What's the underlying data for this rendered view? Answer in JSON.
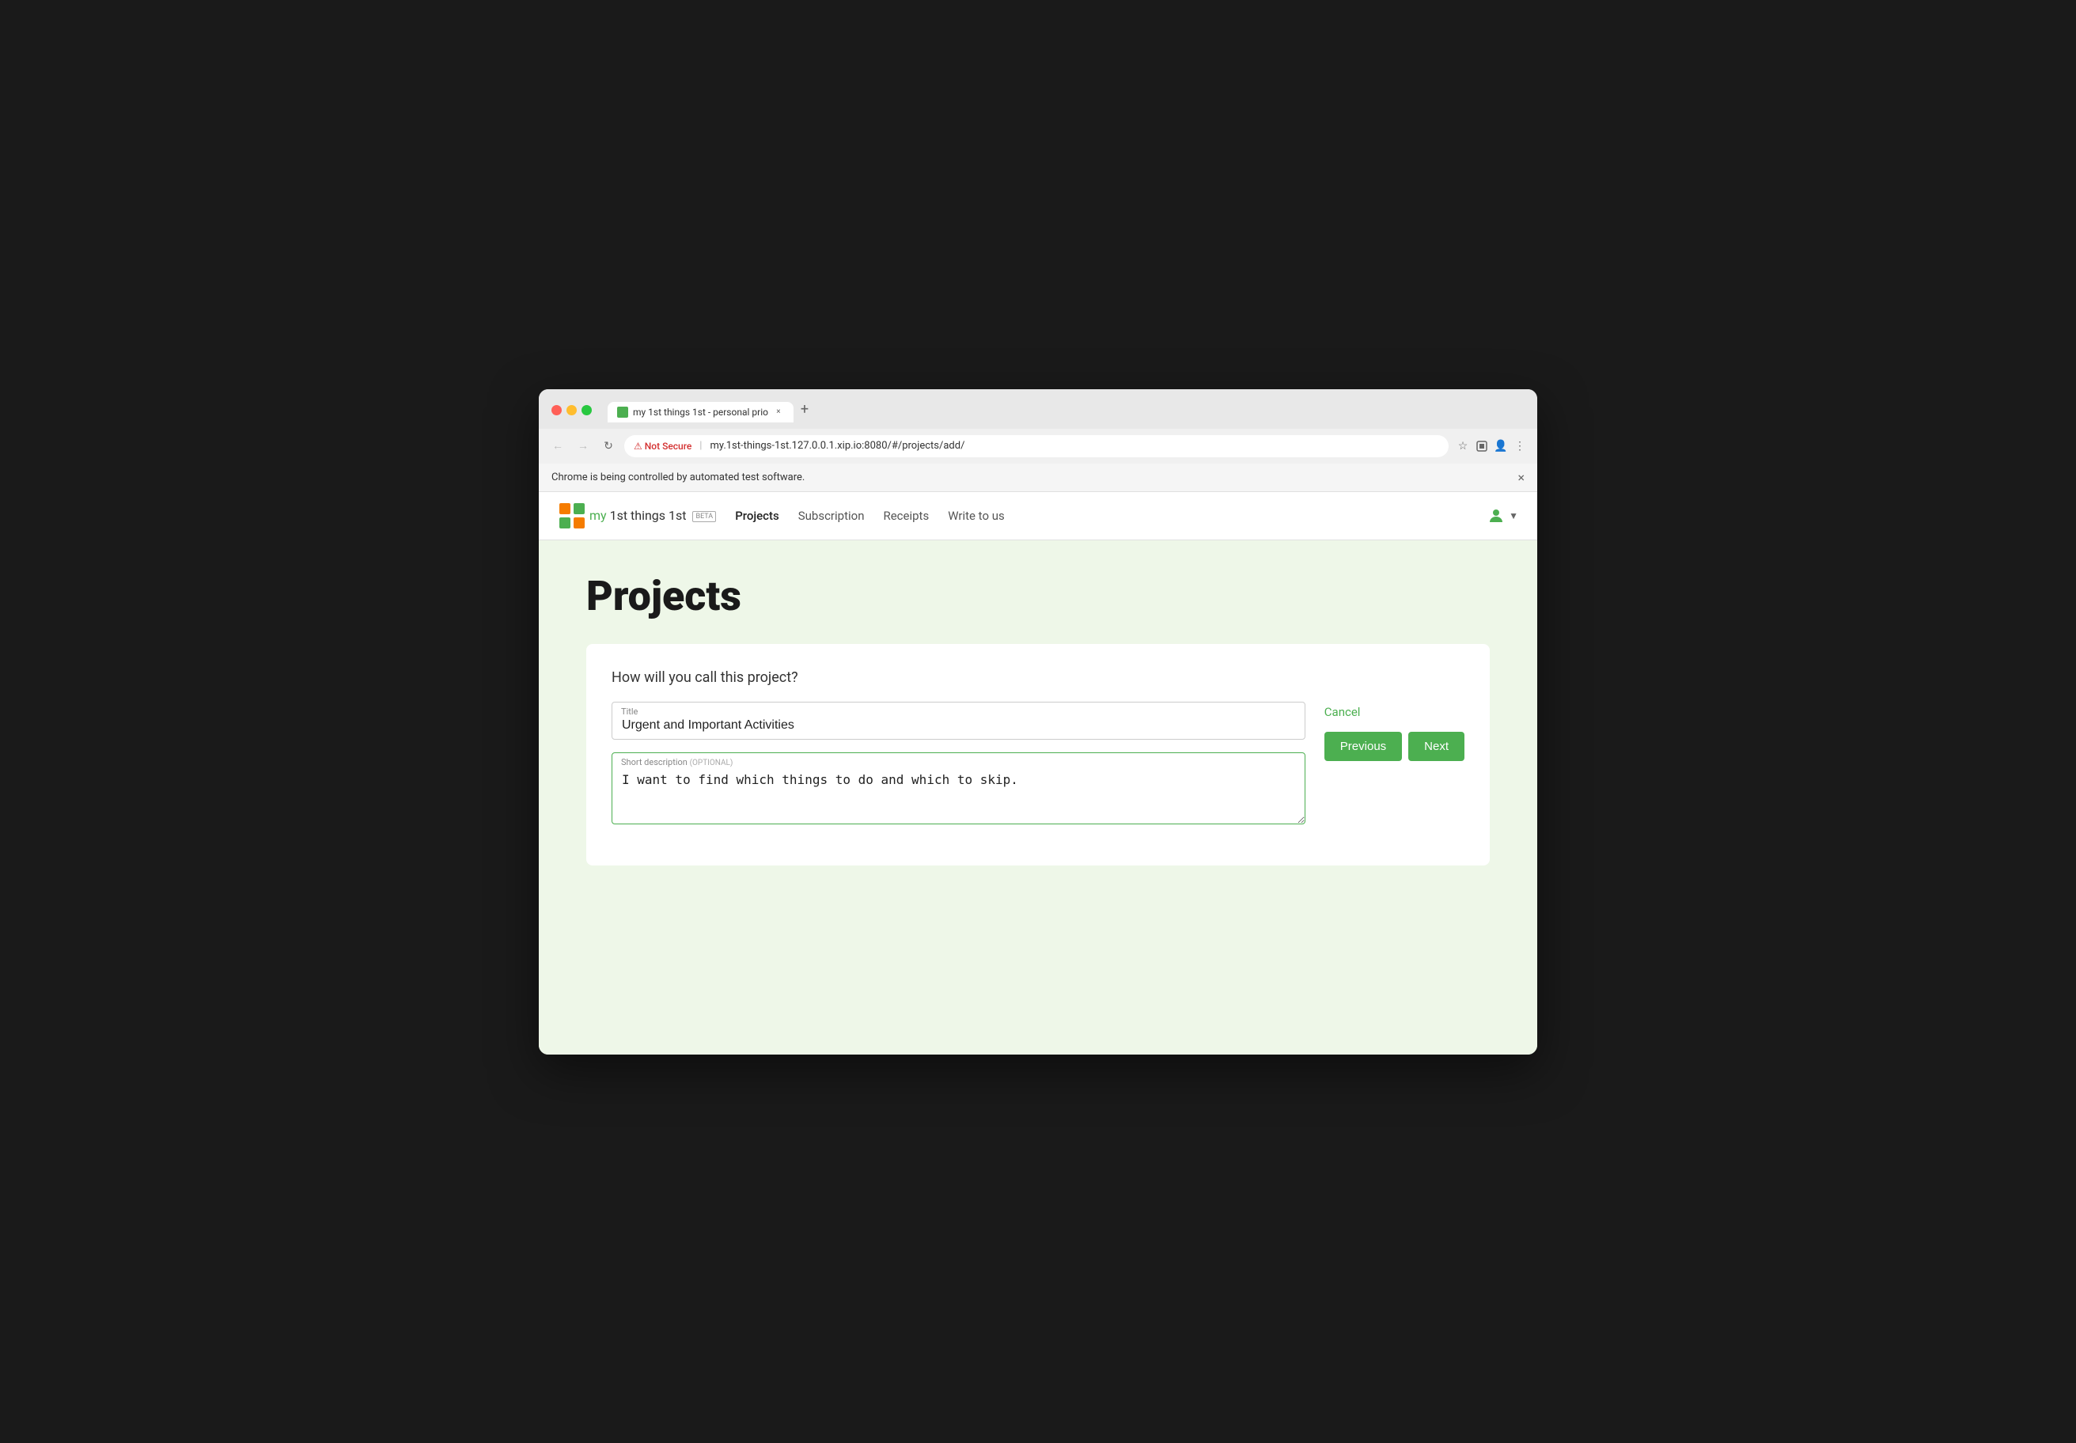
{
  "browser": {
    "tab_title": "my 1st things 1st - personal prio",
    "tab_close": "×",
    "tab_new": "+",
    "nav_back": "←",
    "nav_forward": "→",
    "nav_refresh": "↻",
    "not_secure_label": "Not Secure",
    "address_url": "my.1st-things-1st.127.0.0.1.xip.io:8080/#/projects/add/",
    "notification_text": "Chrome is being controlled by automated test software.",
    "notification_close": "×"
  },
  "header": {
    "logo_text_my": "my",
    "logo_text_rest": " 1st things 1st",
    "beta_label": "BETA",
    "nav_items": [
      {
        "label": "Projects",
        "active": true
      },
      {
        "label": "Subscription",
        "active": false
      },
      {
        "label": "Receipts",
        "active": false
      },
      {
        "label": "Write to us",
        "active": false
      }
    ],
    "user_dropdown": "▼"
  },
  "main": {
    "page_title": "Projects",
    "form": {
      "question": "How will you call this project?",
      "title_label": "Title",
      "title_value": "Urgent and Important Activities",
      "description_label": "Short description",
      "description_optional": "(OPTIONAL)",
      "description_value": "I want to find which things to do and which to skip.",
      "cancel_label": "Cancel",
      "previous_label": "Previous",
      "next_label": "Next"
    }
  }
}
